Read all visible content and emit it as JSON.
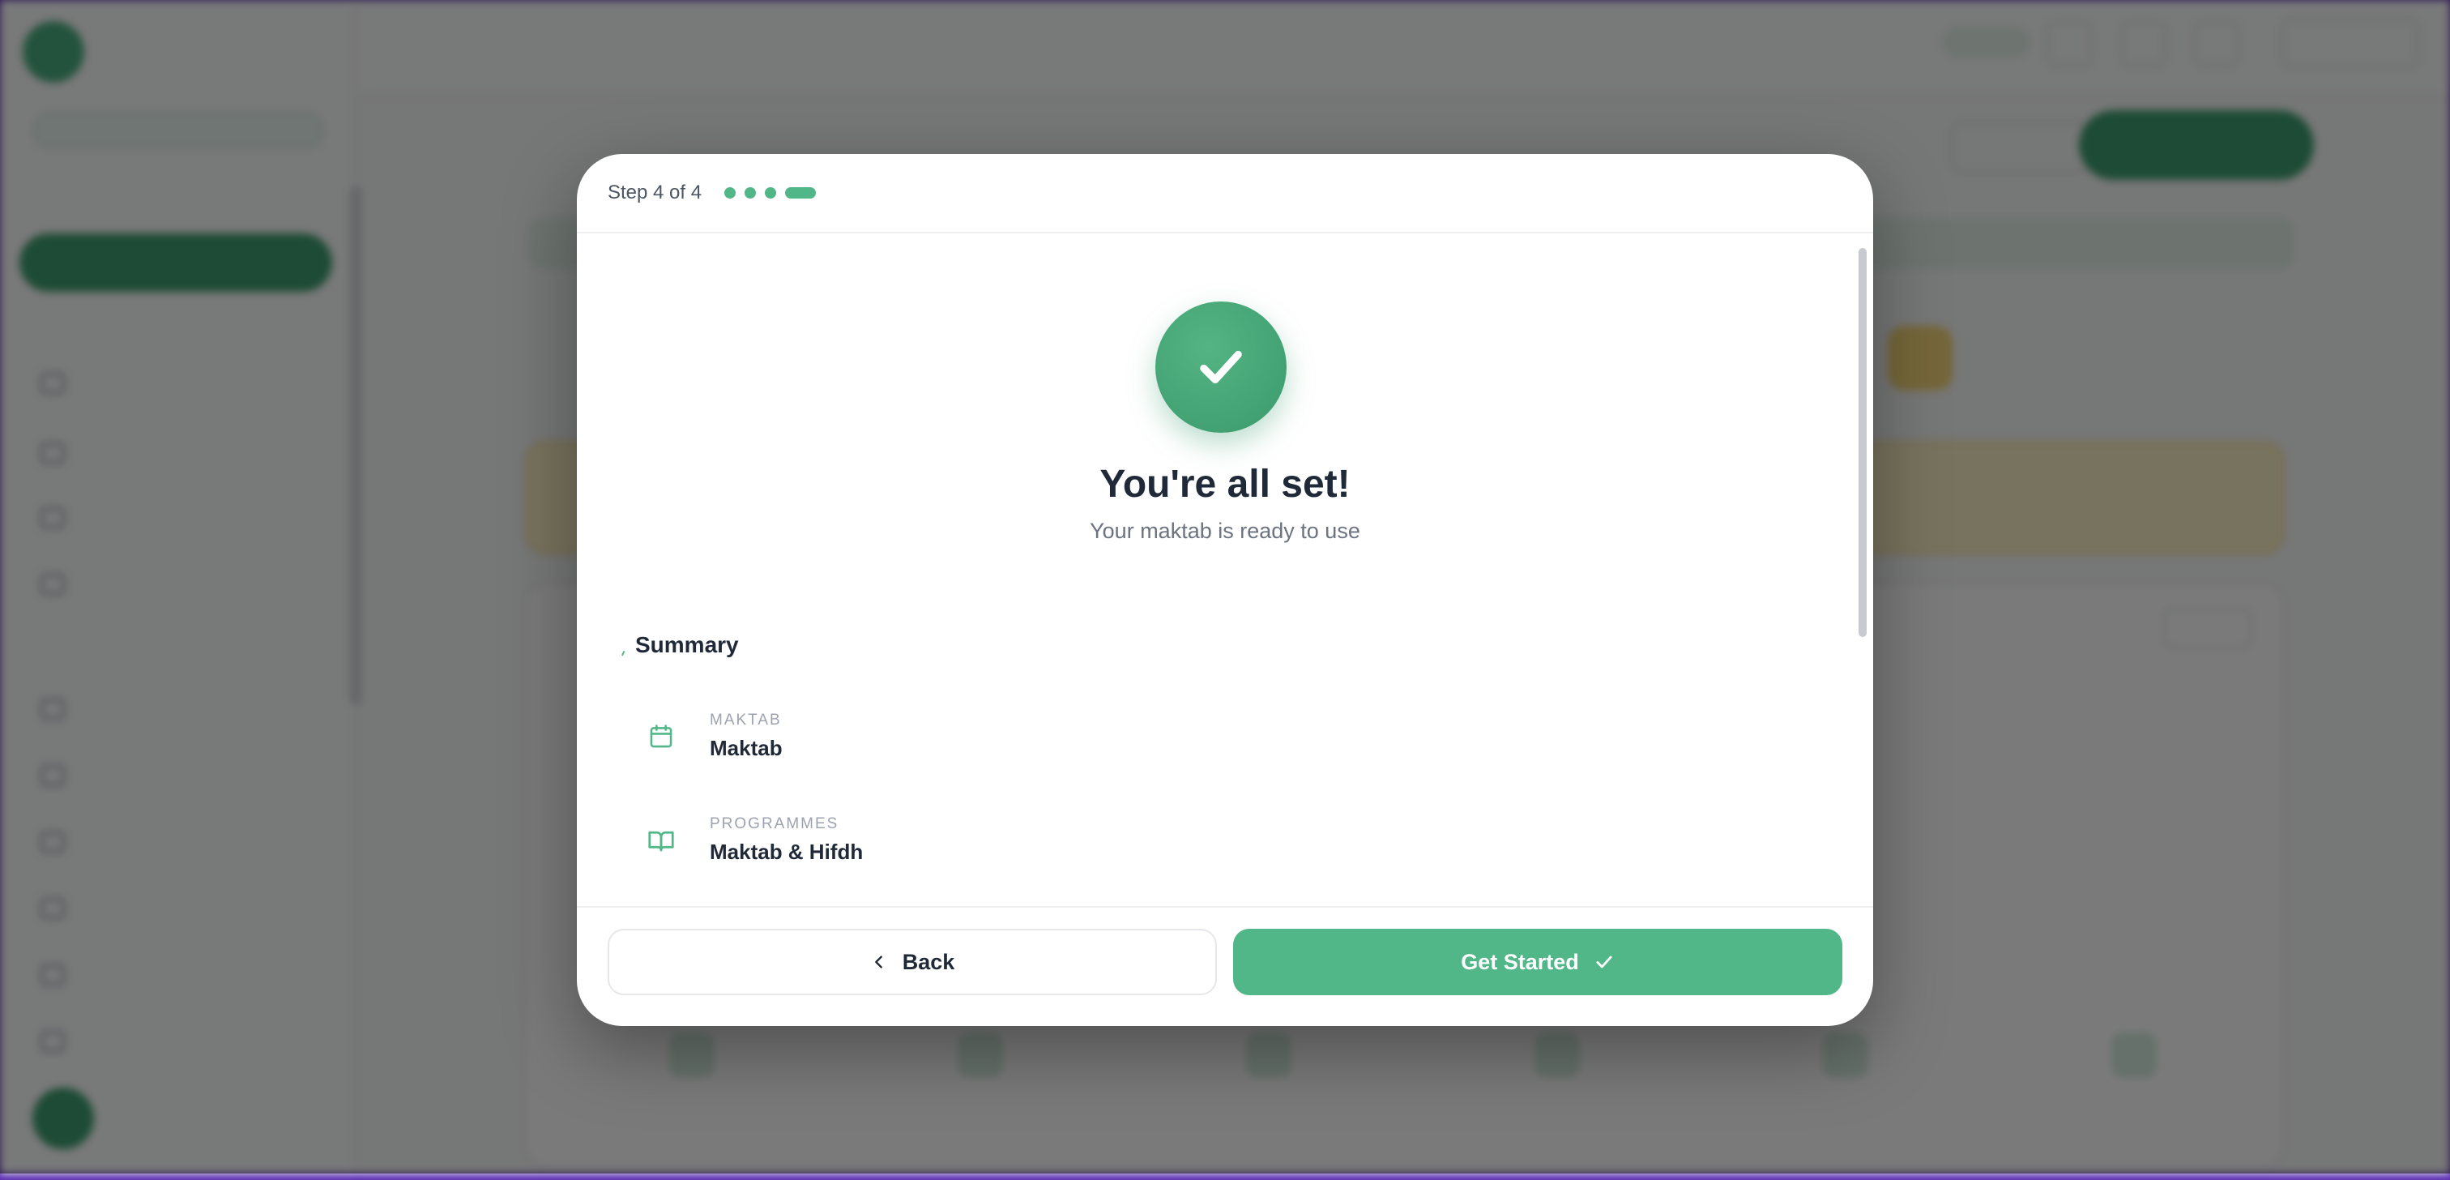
{
  "modal": {
    "step_text": "Step 4 of 4",
    "title": "You're all set!",
    "subtitle": "Your maktab is ready to use",
    "summary_heading": "Summary",
    "summary_items": [
      {
        "label": "MAKTAB",
        "value": "Maktab",
        "icon": "calendar-icon"
      },
      {
        "label": "PROGRAMMES",
        "value": "Maktab & Hifdh",
        "icon": "book-open-icon"
      }
    ],
    "back_label": "Back",
    "start_label": "Get Started",
    "progress_dots": {
      "total": 4,
      "current": 4
    }
  },
  "colors": {
    "accent": "#52b788",
    "accent_dark": "#3e9e70",
    "overlay": "rgba(0,0,0,0.52)",
    "frame": "#5b2fb0"
  }
}
